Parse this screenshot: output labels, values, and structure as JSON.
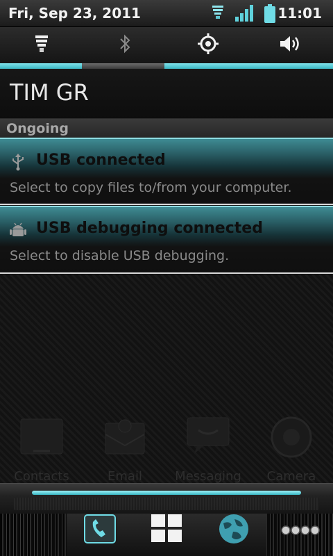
{
  "status_bar": {
    "date": "Fri, Sep 23, 2011",
    "time": "11:01",
    "icons": [
      "flashlight-icon",
      "signal-icon",
      "battery-icon"
    ]
  },
  "toggles": [
    {
      "icon": "flashlight-icon",
      "state": "on"
    },
    {
      "icon": "bluetooth-icon",
      "state": "off"
    },
    {
      "icon": "gps-icon",
      "state": "on"
    },
    {
      "icon": "sound-icon",
      "state": "on"
    }
  ],
  "carrier": "TIM GR",
  "section_header": "Ongoing",
  "notifications": [
    {
      "icon": "usb-icon",
      "title": "USB connected",
      "subtitle": "Select to copy files to/from your computer."
    },
    {
      "icon": "android-debug-icon",
      "title": "USB debugging connected",
      "subtitle": "Select to disable USB debugging."
    }
  ],
  "background_apps": [
    {
      "label": "Contacts",
      "icon": "contacts-icon"
    },
    {
      "label": "Email",
      "icon": "email-icon"
    },
    {
      "label": "Messaging",
      "icon": "messaging-icon"
    },
    {
      "label": "Camera",
      "icon": "camera-icon"
    }
  ],
  "dock": [
    {
      "icon": "phone-icon"
    },
    {
      "icon": "app-drawer-icon"
    },
    {
      "icon": "browser-icon"
    },
    {
      "icon": "more-dots-icon"
    }
  ],
  "colors": {
    "accent": "#3bb6c2",
    "notification_title": "#0e0e0e",
    "notification_subtitle": "#8a8a8a"
  }
}
